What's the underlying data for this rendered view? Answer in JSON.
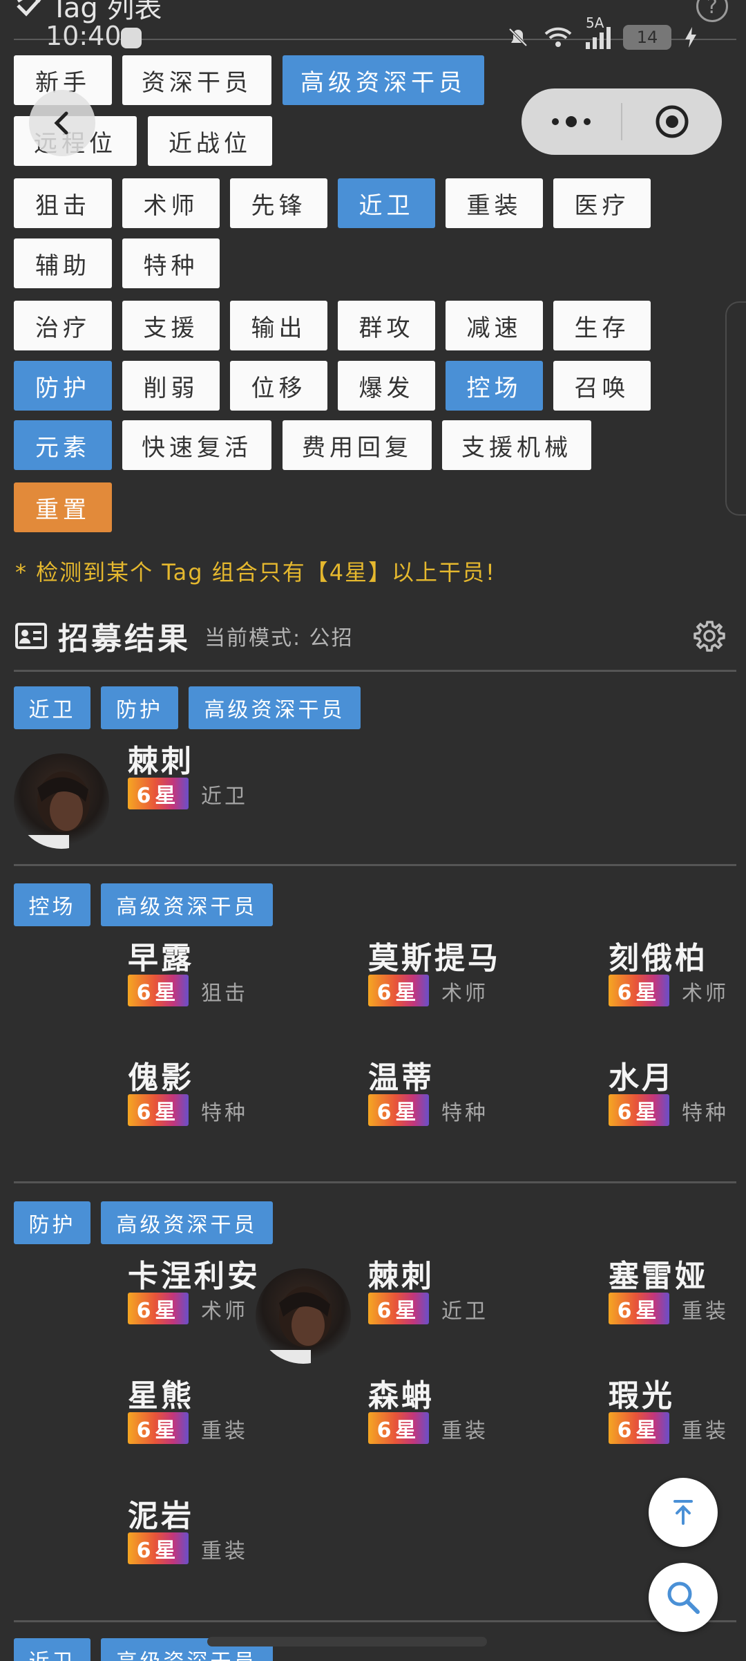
{
  "status_bar": {
    "time": "10:40",
    "network": "5A",
    "battery": "14"
  },
  "header": {
    "title": "Tag 列表",
    "help": "?"
  },
  "tags": {
    "qualification": [
      {
        "label": "新手",
        "selected": false
      },
      {
        "label": "资深干员",
        "selected": false
      },
      {
        "label": "高级资深干员",
        "selected": true
      }
    ],
    "position": [
      {
        "label": "远程位",
        "selected": false
      },
      {
        "label": "近战位",
        "selected": false
      }
    ],
    "profession": [
      {
        "label": "狙击",
        "selected": false
      },
      {
        "label": "术师",
        "selected": false
      },
      {
        "label": "先锋",
        "selected": false
      },
      {
        "label": "近卫",
        "selected": true
      },
      {
        "label": "重装",
        "selected": false
      },
      {
        "label": "医疗",
        "selected": false
      },
      {
        "label": "辅助",
        "selected": false
      },
      {
        "label": "特种",
        "selected": false
      }
    ],
    "affix": [
      {
        "label": "治疗",
        "selected": false
      },
      {
        "label": "支援",
        "selected": false
      },
      {
        "label": "输出",
        "selected": false
      },
      {
        "label": "群攻",
        "selected": false
      },
      {
        "label": "减速",
        "selected": false
      },
      {
        "label": "生存",
        "selected": false
      },
      {
        "label": "防护",
        "selected": true
      },
      {
        "label": "削弱",
        "selected": false
      },
      {
        "label": "位移",
        "selected": false
      },
      {
        "label": "爆发",
        "selected": false
      },
      {
        "label": "控场",
        "selected": true
      },
      {
        "label": "召唤",
        "selected": false
      },
      {
        "label": "元素",
        "selected": true
      },
      {
        "label": "快速复活",
        "selected": false
      },
      {
        "label": "费用回复",
        "selected": false
      },
      {
        "label": "支援机械",
        "selected": false
      }
    ],
    "reset_label": "重置"
  },
  "warning": "* 检测到某个 Tag 组合只有【4星】以上干员!",
  "results": {
    "title": "招募结果",
    "mode_label": "当前模式: 公招",
    "groups": [
      {
        "tags": [
          "近卫",
          "防护",
          "高级资深干员"
        ],
        "operators": [
          {
            "name": "棘刺",
            "star": "6星",
            "class": "近卫"
          }
        ]
      },
      {
        "tags": [
          "控场",
          "高级资深干员"
        ],
        "operators": [
          {
            "name": "早露",
            "star": "6星",
            "class": "狙击"
          },
          {
            "name": "莫斯提马",
            "star": "6星",
            "class": "术师"
          },
          {
            "name": "刻俄柏",
            "star": "6星",
            "class": "术师"
          },
          {
            "name": "傀影",
            "star": "6星",
            "class": "特种"
          },
          {
            "name": "温蒂",
            "star": "6星",
            "class": "特种"
          },
          {
            "name": "水月",
            "star": "6星",
            "class": "特种"
          }
        ]
      },
      {
        "tags": [
          "防护",
          "高级资深干员"
        ],
        "operators": [
          {
            "name": "卡涅利安",
            "star": "6星",
            "class": "术师"
          },
          {
            "name": "棘刺",
            "star": "6星",
            "class": "近卫"
          },
          {
            "name": "塞雷娅",
            "star": "6星",
            "class": "重装"
          },
          {
            "name": "星熊",
            "star": "6星",
            "class": "重装"
          },
          {
            "name": "森蚺",
            "star": "6星",
            "class": "重装"
          },
          {
            "name": "瑕光",
            "star": "6星",
            "class": "重装"
          },
          {
            "name": "泥岩",
            "star": "6星",
            "class": "重装"
          }
        ]
      },
      {
        "tags": [
          "近卫",
          "高级资深干员"
        ],
        "operators": []
      }
    ]
  },
  "colors": {
    "selected": "#4a90d6",
    "reset": "#e28a3a",
    "warning": "#e5b82e",
    "background": "#2e2e2e"
  },
  "icons": [
    "back-icon",
    "more-icon",
    "close-target-icon",
    "gear-icon",
    "id-card-icon",
    "scroll-top-icon",
    "search-icon",
    "help-icon",
    "tag-check-icon"
  ]
}
